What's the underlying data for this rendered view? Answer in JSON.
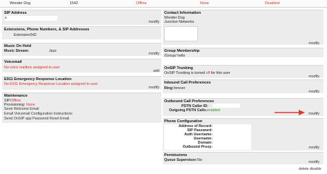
{
  "topbar": {
    "name": "Wonder Dog",
    "extension": "1542",
    "status1": "Offline",
    "status2": "None",
    "status3": "Disabled"
  },
  "sip_address": {
    "title": "SIP Address",
    "value": "s",
    "modify": "modify"
  },
  "extensions": {
    "title": "Extensions, Phone Numbers, & SIP Addresses",
    "label": "Extension:",
    "value": "542"
  },
  "music_on_hold": {
    "title": "Music On Hold",
    "label": "Music Stream:",
    "value": "Jazz",
    "modify": "modify"
  },
  "voicemail": {
    "title": "Voicemail",
    "status": "No voice mailbox assigned to user",
    "add": "add"
  },
  "e911": {
    "title": "E911 Emergency Response Location",
    "status": "No E911 Emergency Response Location assigned to user",
    "modify": "modify"
  },
  "maintenance": {
    "title": "Maintenance",
    "sip_label": "SIP:",
    "sip_value": "Offline",
    "provisioning_label": "Provisioning:",
    "provisioning_value": "None",
    "links": [
      "Send Welcome Email",
      "Email Voicemail Configuration Instructions",
      "Send OnSIP app Password Reset Email"
    ]
  },
  "contact_info": {
    "title": "Contact Information",
    "name": "Wonder Dog",
    "org": "Junction Networks",
    "modify": "modify"
  },
  "group_membership": {
    "title": "Group Membership",
    "value": "/Group/ hello"
  },
  "onsip_trunking": {
    "title": "OnSIP Trunking",
    "value": "OnSIP Trunking is turned",
    "value_off": "off",
    "value_tail": "for this user",
    "modify": "modify"
  },
  "inbound_prefs": {
    "title": "Inbound Call Preferences",
    "ring_label": "Ring:",
    "ring_value": "forever",
    "modify": "modify"
  },
  "outbound_prefs": {
    "title": "Outbound Call Preferences",
    "pstn_id_label": "PSTN Caller ID:",
    "pstn_calls_label": "Outgoing PSTN Calls:",
    "pstn_calls_value": "enabled",
    "modify": "modify"
  },
  "phone_config": {
    "title": "Phone Configuration",
    "fields": [
      "Address of Record:",
      "SIP Password:",
      "Auth Username:",
      "Username:",
      "Domain:",
      "Outbound Proxy:"
    ],
    "modify": "modify"
  },
  "permissions": {
    "title": "Permissions",
    "label": "Queue Supervisor:",
    "value": "No",
    "modify": "modify"
  },
  "footer": {
    "delete": "delete",
    "disable": "disable"
  },
  "colors": {
    "red": "#d9302a",
    "green": "#2f8f2f",
    "panel": "#ececec"
  }
}
